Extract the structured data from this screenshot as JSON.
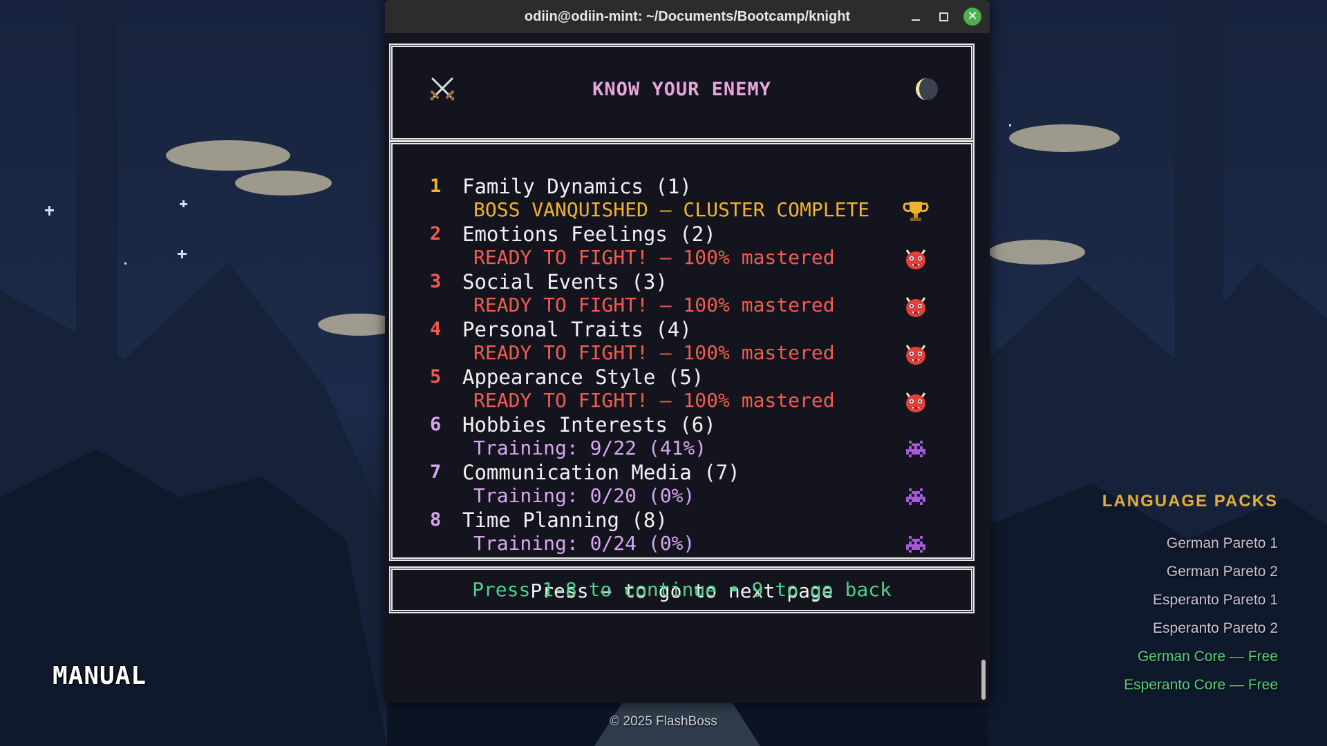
{
  "window": {
    "title": "odiin@odiin-mint: ~/Documents/Bootcamp/knight",
    "minimize_glyph": "–",
    "close_glyph": "✕"
  },
  "screen": {
    "title": "KNOW YOUR ENEMY",
    "next_page_hint": "Press → to go to next page",
    "footer": "Press 1-8 to continue • 9 to go back"
  },
  "clusters": [
    {
      "number": "1",
      "name": "Family Dynamics (1)",
      "status": "BOSS VANQUISHED – CLUSTER COMPLETE",
      "state": "complete",
      "icon": "trophy-icon"
    },
    {
      "number": "2",
      "name": "Emotions Feelings (2)",
      "status": "READY TO FIGHT! – 100% mastered",
      "state": "ready",
      "icon": "ogre-icon"
    },
    {
      "number": "3",
      "name": "Social Events (3)",
      "status": "READY TO FIGHT! – 100% mastered",
      "state": "ready",
      "icon": "ogre-icon"
    },
    {
      "number": "4",
      "name": "Personal Traits (4)",
      "status": "READY TO FIGHT! – 100% mastered",
      "state": "ready",
      "icon": "ogre-icon"
    },
    {
      "number": "5",
      "name": "Appearance Style (5)",
      "status": "READY TO FIGHT! – 100% mastered",
      "state": "ready",
      "icon": "ogre-icon"
    },
    {
      "number": "6",
      "name": "Hobbies Interests (6)",
      "status": "Training: 9/22 (41%)",
      "state": "training",
      "icon": "space-invader-icon"
    },
    {
      "number": "7",
      "name": "Communication Media (7)",
      "status": "Training: 0/20 (0%)",
      "state": "training",
      "icon": "space-invader-icon"
    },
    {
      "number": "8",
      "name": "Time Planning (8)",
      "status": "Training: 0/24 (0%)",
      "state": "training",
      "icon": "space-invader-icon"
    }
  ],
  "desktop": {
    "manual_label": "MANUAL",
    "language_packs": {
      "title": "LANGUAGE PACKS",
      "items": [
        {
          "label": "German Pareto 1",
          "free": false
        },
        {
          "label": "German Pareto 2",
          "free": false
        },
        {
          "label": "Esperanto Pareto 1",
          "free": false
        },
        {
          "label": "Esperanto Pareto 2",
          "free": false
        },
        {
          "label": "German Core — Free",
          "free": true
        },
        {
          "label": "Esperanto Core — Free",
          "free": true
        }
      ]
    },
    "copyright": "© 2025 FlashBoss"
  },
  "colors": {
    "complete": "#f0b429",
    "ready": "#f25c4f",
    "training": "#d7a6ef",
    "training_number": "#d7a6ef",
    "title": "#e8a6d8",
    "footer": "#4fd18b",
    "lang_title": "#e2ae3c",
    "lang_free": "#55d07c",
    "number_1": "#f0b429",
    "number_ready": "#f25c4f"
  },
  "icons": {
    "header_left": "crossed-swords-icon",
    "header_right": "crescent-moon-icon"
  }
}
